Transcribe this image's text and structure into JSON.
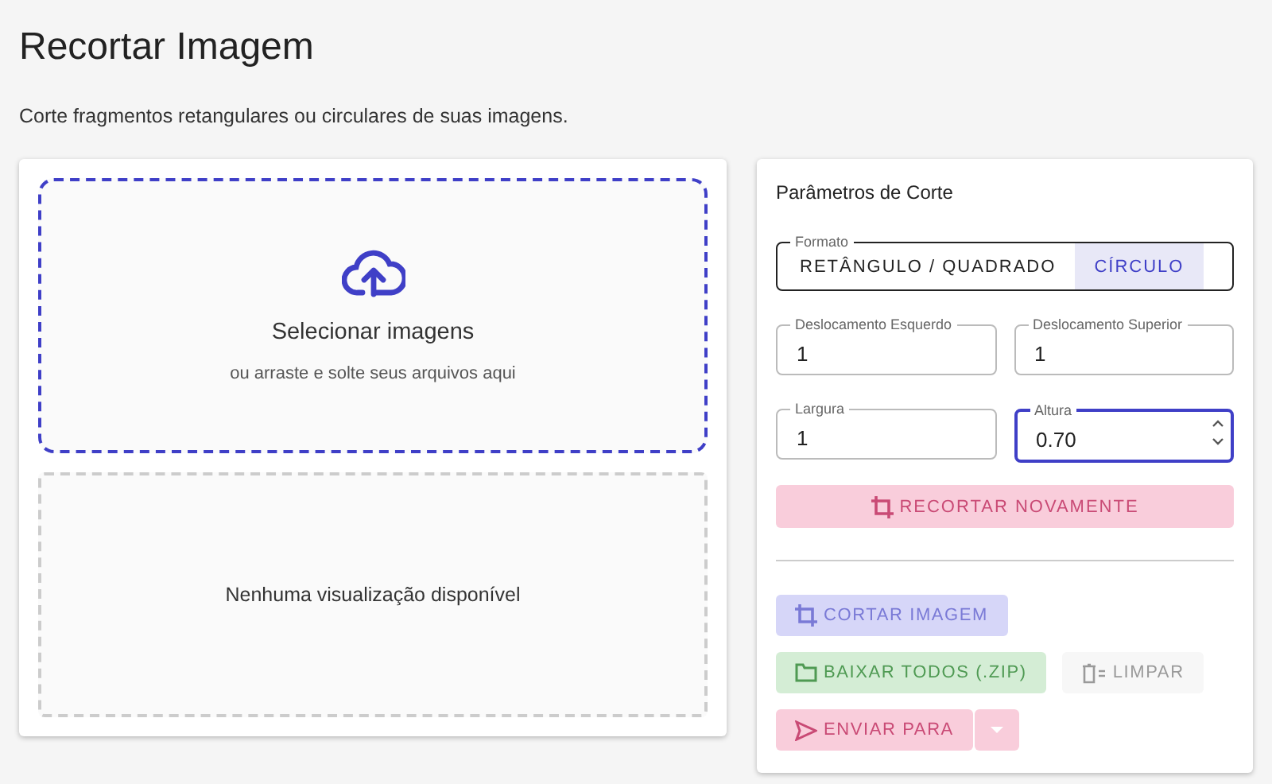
{
  "page": {
    "title": "Recortar Imagem",
    "subtitle": "Corte fragmentos retangulares ou circulares de suas imagens."
  },
  "dropzone": {
    "title": "Selecionar imagens",
    "hint": "ou arraste e solte seus arquivos aqui"
  },
  "preview": {
    "empty_text": "Nenhuma visualização disponível"
  },
  "params": {
    "title": "Parâmetros de Corte",
    "format": {
      "label": "Formato",
      "options": [
        {
          "label": "RETÂNGULO / QUADRADO",
          "selected": false
        },
        {
          "label": "CÍRCULO",
          "selected": true
        }
      ]
    },
    "fields": [
      {
        "label": "Deslocamento Esquerdo",
        "value": "1",
        "focused": false
      },
      {
        "label": "Deslocamento Superior",
        "value": "1",
        "focused": false
      },
      {
        "label": "Largura",
        "value": "1",
        "focused": false
      },
      {
        "label": "Altura",
        "value": "0.70",
        "focused": true
      }
    ],
    "recrop_button": {
      "label": "RECORTAR NOVAMENTE",
      "disabled": true
    }
  },
  "actions": [
    {
      "kind": "crop",
      "label": "CORTAR IMAGEM",
      "disabled": true
    },
    {
      "kind": "zip",
      "label": "BAIXAR TODOS (.ZIP)",
      "disabled": true
    },
    {
      "kind": "clear",
      "label": "LIMPAR",
      "disabled": true
    },
    {
      "kind": "send",
      "label": "ENVIAR PARA",
      "disabled": true
    }
  ]
}
